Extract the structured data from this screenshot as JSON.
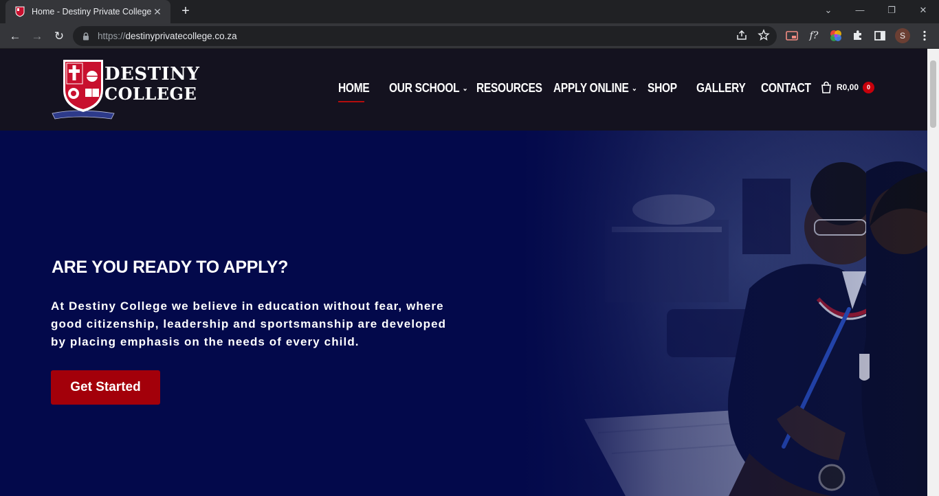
{
  "browser": {
    "tab_title": "Home - Destiny Private College",
    "tab_close": "✕",
    "new_tab": "+",
    "url_scheme": "https://",
    "url_host": "destinyprivatecollege.co.za",
    "profile_initial": "S",
    "window_controls": {
      "tab_search": "⌄",
      "minimize": "—",
      "restore": "❐",
      "close": "✕"
    },
    "nav": {
      "back": "←",
      "forward": "→",
      "reload": "↻"
    },
    "ext_fx_label": "f?"
  },
  "site": {
    "logo_line1": "DESTINY",
    "logo_line2": "COLLEGE",
    "nav": [
      {
        "label": "HOME",
        "has_dropdown": false
      },
      {
        "label": "OUR SCHOOL",
        "has_dropdown": true
      },
      {
        "label": "RESOURCES",
        "has_dropdown": false
      },
      {
        "label": "APPLY ONLINE",
        "has_dropdown": true
      },
      {
        "label": "SHOP",
        "has_dropdown": false
      },
      {
        "label": "GALLERY",
        "has_dropdown": false
      },
      {
        "label": "CONTACT",
        "has_dropdown": false
      }
    ],
    "caret": "⌄",
    "cart": {
      "amount": "R0,00",
      "count": "0"
    },
    "hero": {
      "heading": "ARE YOU READY TO APPLY?",
      "text": "At Destiny College we believe in education without fear, where good citizenship, leadership and sportsmanship are developed by placing emphasis on the needs of every child.",
      "button": "Get Started"
    }
  },
  "colors": {
    "header_bg": "#14121f",
    "hero_bg": "#03094b",
    "accent_red": "#a3000a",
    "active_underline": "#b50d0d"
  }
}
